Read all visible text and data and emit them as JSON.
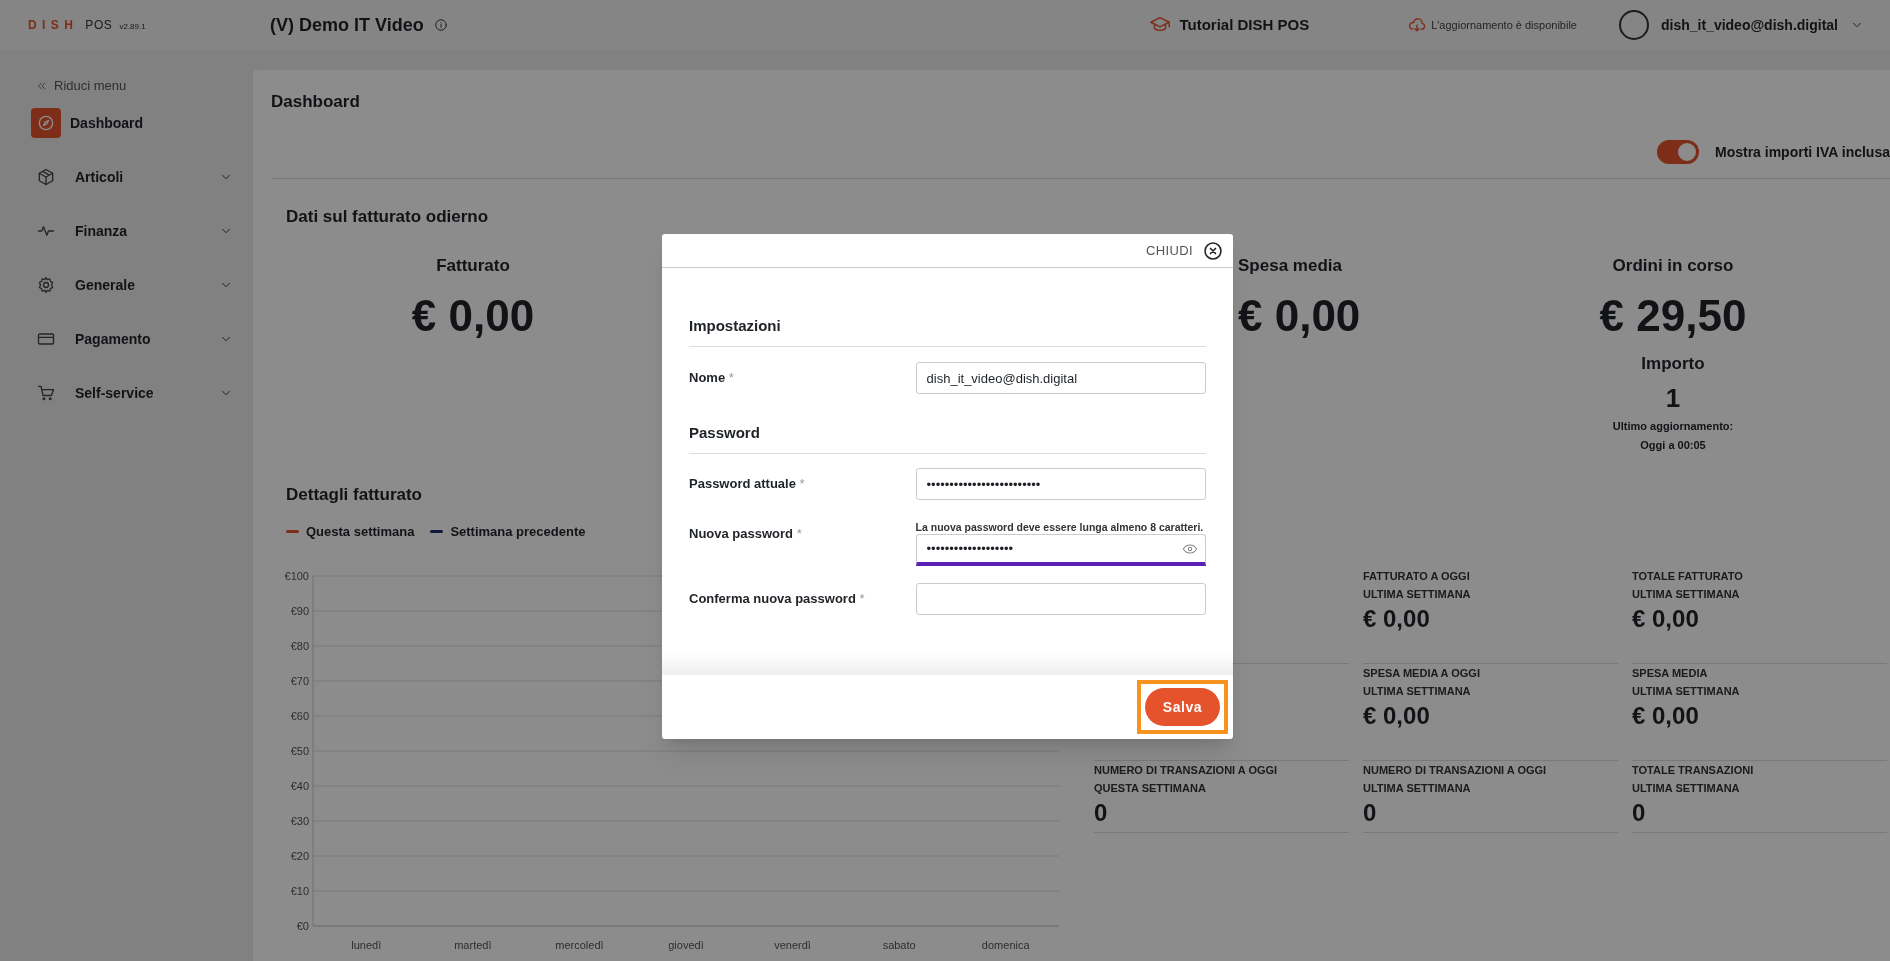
{
  "header": {
    "logo": {
      "brand": "DISH",
      "product": "POS",
      "version": "v2.89.1"
    },
    "venue": "(V) Demo IT Video",
    "tutorial": "Tutorial DISH POS",
    "update_notice": "L'aggiornamento è disponibile",
    "user": "dish_it_video@dish.digital"
  },
  "sidebar": {
    "collapse": "Riduci menu",
    "items": [
      {
        "label": "Dashboard",
        "selected": true,
        "expandable": false
      },
      {
        "label": "Articoli",
        "selected": false,
        "expandable": true
      },
      {
        "label": "Finanza",
        "selected": false,
        "expandable": true
      },
      {
        "label": "Generale",
        "selected": false,
        "expandable": true
      },
      {
        "label": "Pagamento",
        "selected": false,
        "expandable": true
      },
      {
        "label": "Self-service",
        "selected": false,
        "expandable": true
      }
    ]
  },
  "dashboard": {
    "title": "Dashboard",
    "vat_toggle": {
      "label": "Mostra importi IVA inclusa",
      "on": true
    },
    "today": {
      "title": "Dati sul fatturato odierno",
      "stats": [
        {
          "label": "Fatturato",
          "value": "€ 0,00"
        },
        {
          "label": "Spesa media",
          "value": "€ 0,00"
        },
        {
          "label": "Ordini in corso",
          "value": "€ 29,50",
          "count_label": "Importo",
          "count": "1",
          "updated_label": "Ultimo aggiornamento:",
          "updated": "Oggi a 00:05"
        }
      ]
    },
    "details": {
      "title": "Dettagli fatturato",
      "chart_data": {
        "type": "line",
        "grid": true,
        "categories": [
          "lunedì",
          "martedì",
          "mercoledì",
          "giovedì",
          "venerdì",
          "sabato",
          "domenica"
        ],
        "ylim": [
          0,
          100
        ],
        "yticks": [
          {
            "value": 0,
            "label": "€0"
          },
          {
            "value": 10,
            "label": "€10"
          },
          {
            "value": 20,
            "label": "€20"
          },
          {
            "value": 30,
            "label": "€30"
          },
          {
            "value": 40,
            "label": "€40"
          },
          {
            "value": 50,
            "label": "€50"
          },
          {
            "value": 60,
            "label": "€60"
          },
          {
            "value": 70,
            "label": "€70"
          },
          {
            "value": 80,
            "label": "€80"
          },
          {
            "value": 90,
            "label": "€90"
          },
          {
            "value": 100,
            "label": "€100"
          }
        ],
        "series": [
          {
            "name": "Questa settimana",
            "color": "#e5532d",
            "values": [
              null,
              null,
              null,
              null,
              null,
              null,
              null
            ]
          },
          {
            "name": "Settimana precedente",
            "color": "#1c2e6e",
            "values": [
              null,
              null,
              null,
              null,
              null,
              null,
              null
            ]
          }
        ]
      }
    },
    "weekly_stats": [
      {
        "label_lines": [
          "FATTURATO A OGGI",
          "ULTIMA SETTIMANA"
        ],
        "value": "€ 0,00"
      },
      {
        "label_lines": [
          "TOTALE FATTURATO",
          "ULTIMA SETTIMANA"
        ],
        "value": "€ 0,00"
      },
      {
        "label_lines": [
          "SPESA MEDIA A OGGI",
          "ULTIMA SETTIMANA"
        ],
        "value": "€ 0,00"
      },
      {
        "label_lines": [
          "SPESA MEDIA",
          "ULTIMA SETTIMANA"
        ],
        "value": "€ 0,00"
      },
      {
        "label_lines": [
          "NUMERO DI TRANSAZIONI A OGGI",
          "QUESTA SETTIMANA"
        ],
        "value": "0"
      },
      {
        "label_lines": [
          "NUMERO DI TRANSAZIONI A OGGI",
          "ULTIMA SETTIMANA"
        ],
        "value": "0"
      },
      {
        "label_lines": [
          "TOTALE TRANSAZIONI",
          "ULTIMA SETTIMANA"
        ],
        "value": "0"
      }
    ]
  },
  "modal": {
    "close": "CHIUDI",
    "sections": [
      {
        "title": "Impostazioni",
        "fields": [
          {
            "label": "Nome",
            "required_mark": "*",
            "value": "dish_it_video@dish.digital"
          }
        ]
      },
      {
        "title": "Password",
        "fields": [
          {
            "label": "Password attuale",
            "required_mark": "*",
            "value": "•••••••••••••••••••••••••"
          },
          {
            "label": "Nuova password",
            "required_mark": "*",
            "hint": "La nuova password deve essere lunga almeno 8 caratteri.",
            "value": "•••••••••••••••••••",
            "reveal_toggle": true,
            "focused": true
          },
          {
            "label": "Conferma nuova password",
            "required_mark": "*",
            "focused": false
          }
        ]
      }
    ],
    "save": "Salva",
    "save_highlighted": true
  }
}
